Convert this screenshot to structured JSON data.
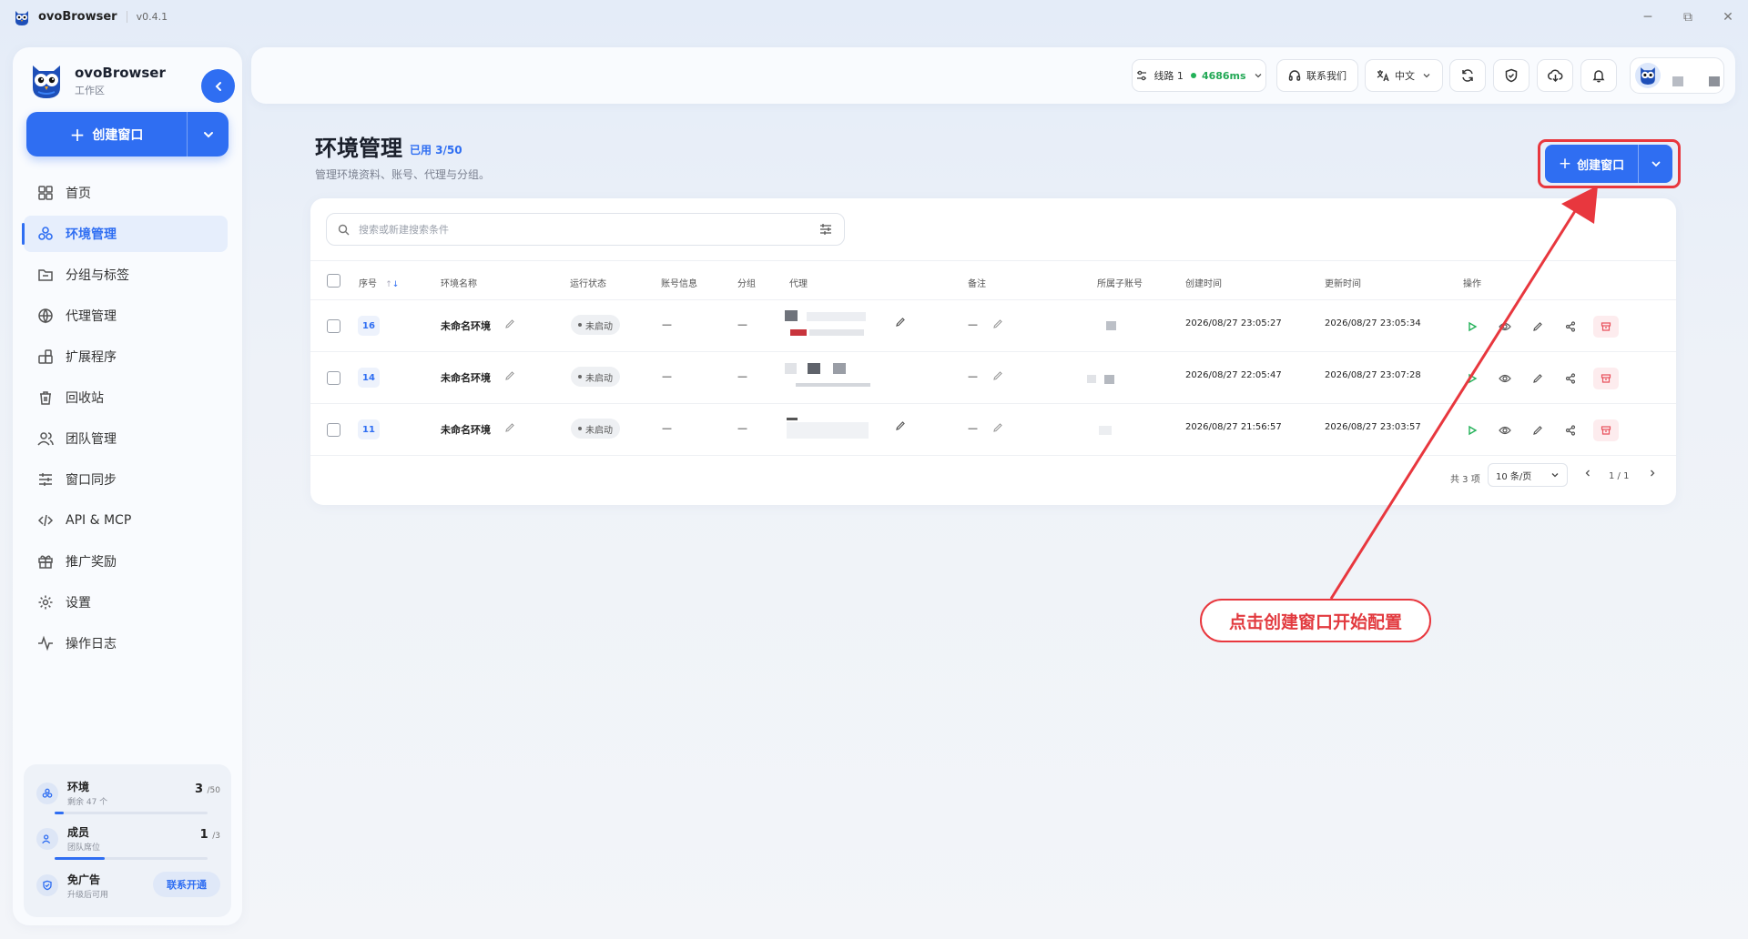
{
  "app": {
    "name": "ovoBrowser",
    "version": "v0.4.1"
  },
  "window_controls": {
    "minimize": "─",
    "restore": "⧉",
    "close": "✕"
  },
  "sidebar": {
    "brand_name": "ovoBrowser",
    "brand_sub": "工作区",
    "create_label": "创建窗口",
    "items": [
      {
        "label": "首页",
        "icon": "grid-icon"
      },
      {
        "label": "环境管理",
        "icon": "cubes-icon",
        "active": true
      },
      {
        "label": "分组与标签",
        "icon": "folder-icon"
      },
      {
        "label": "代理管理",
        "icon": "globe-icon"
      },
      {
        "label": "扩展程序",
        "icon": "puzzle-icon"
      },
      {
        "label": "回收站",
        "icon": "trash-icon"
      },
      {
        "label": "团队管理",
        "icon": "team-icon"
      },
      {
        "label": "窗口同步",
        "icon": "sliders-icon"
      },
      {
        "label": "API & MCP",
        "icon": "code-icon"
      },
      {
        "label": "推广奖励",
        "icon": "gift-icon"
      },
      {
        "label": "设置",
        "icon": "gear-icon"
      },
      {
        "label": "操作日志",
        "icon": "activity-icon"
      }
    ],
    "quota": {
      "env": {
        "title": "环境",
        "sub": "剩余 47 个",
        "value": "3",
        "total": "/50",
        "progress": 0.06
      },
      "members": {
        "title": "成员",
        "sub": "团队席位",
        "value": "1",
        "total": "/3",
        "progress": 0.33
      },
      "adfree": {
        "title": "免广告",
        "sub": "升级后可用",
        "button": "联系开通"
      }
    }
  },
  "topbar": {
    "line_label": "线路 1",
    "latency": "4686ms",
    "contact_label": "联系我们",
    "language": "中文"
  },
  "page": {
    "title": "环境管理",
    "used": "已用 3/50",
    "description": "管理环境资料、账号、代理与分组。",
    "create_label": "创建窗口"
  },
  "table": {
    "search_placeholder": "搜索或新建搜索条件",
    "headers": {
      "index": "序号",
      "name": "环境名称",
      "status": "运行状态",
      "account": "账号信息",
      "group": "分组",
      "proxy": "代理",
      "note": "备注",
      "sub_account": "所属子账号",
      "created": "创建时间",
      "updated": "更新时间",
      "actions": "操作"
    },
    "rows": [
      {
        "index": "16",
        "name": "未命名环境",
        "status": "未启动",
        "account": "—",
        "group": "—",
        "note": "—",
        "created": "2026/08/27 23:05:27",
        "updated": "2026/08/27 23:05:34"
      },
      {
        "index": "14",
        "name": "未命名环境",
        "status": "未启动",
        "account": "—",
        "group": "—",
        "note": "—",
        "created": "2026/08/27 22:05:47",
        "updated": "2026/08/27 23:07:28"
      },
      {
        "index": "11",
        "name": "未命名环境",
        "status": "未启动",
        "account": "—",
        "group": "—",
        "note": "—",
        "created": "2026/08/27 21:56:57",
        "updated": "2026/08/27 23:03:57"
      }
    ],
    "pagination": {
      "total": "共 3 项",
      "page_size": "10 条/页",
      "page": "1 / 1"
    }
  },
  "annotation": {
    "text": "点击创建窗口开始配置"
  },
  "colors": {
    "accent": "#2f6ef2",
    "annotation": "#e8373e",
    "success": "#22b158"
  }
}
